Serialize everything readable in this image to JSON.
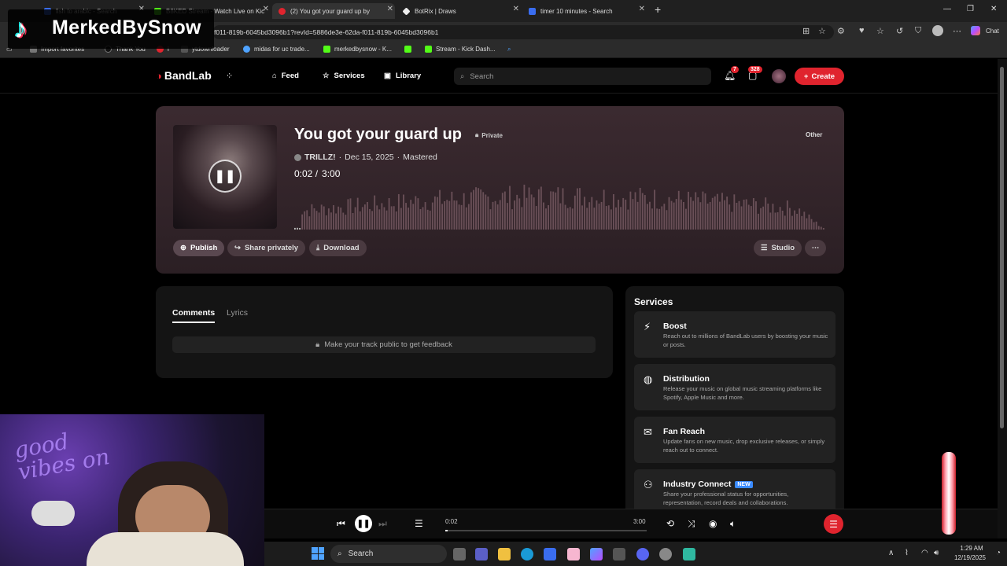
{
  "browser": {
    "tabs": [
      {
        "label": "lish to arabic - Search",
        "color": "#3a6df0"
      },
      {
        "label": "B8KED Stream - Watch Live on Kic",
        "color": "#53fc18"
      },
      {
        "label": "(2) You got your guard up by",
        "color": "#e0242e"
      },
      {
        "label": "BotRix | Draws",
        "color": "#eeeeee"
      },
      {
        "label": "timer 10 minutes - Search",
        "color": "#3a6df0"
      }
    ],
    "url": "f011-819b-6045bd3096b1?revId=5886de3e-62da-f011-819b-6045bd3096b1",
    "chat_label": "Chat",
    "bookmarks": [
      "Import favorites",
      "Thank You",
      "i",
      "ytdownloader",
      "midas for uc trade...",
      "merkedbysnow - K...",
      "Stream - Kick Dash..."
    ]
  },
  "nav": {
    "brand": "BandLab",
    "feed": "Feed",
    "services": "Services",
    "library": "Library",
    "search_placeholder": "Search",
    "notif_count": "7",
    "msg_count": "328",
    "create": "Create"
  },
  "track": {
    "title": "You got your guard up",
    "privacy": "Private",
    "genre": "Other",
    "artist": "TRILLZ!",
    "date": "Dec 15, 2025",
    "status": "Mastered",
    "time_current": "0:02 /",
    "time_total": "3:00",
    "publish": "Publish",
    "share": "Share privately",
    "download": "Download",
    "studio": "Studio"
  },
  "comments": {
    "tab_comments": "Comments",
    "tab_lyrics": "Lyrics",
    "locked_msg": "Make your track public to get feedback"
  },
  "services": {
    "heading": "Services",
    "items": [
      {
        "name": "Boost",
        "desc": "Reach out to millions of BandLab users by boosting your music or posts.",
        "icon": "lightning-icon"
      },
      {
        "name": "Distribution",
        "desc": "Release your music on global music streaming platforms like Spotify, Apple Music and more.",
        "icon": "globe-icon"
      },
      {
        "name": "Fan Reach",
        "desc": "Update fans on new music, drop exclusive releases, or simply reach out to connect.",
        "icon": "mail-icon"
      },
      {
        "name": "Industry Connect",
        "desc": "Share your professional status for opportunities, representation, record deals and collaborations.",
        "icon": "people-icon",
        "tag": "NEW"
      }
    ]
  },
  "player": {
    "current": "0:02",
    "total": "3:00",
    "progress": 0.011
  },
  "taskbar": {
    "search": "Search",
    "time": "1:29 AM",
    "date": "12/19/2025"
  },
  "overlay": {
    "tiktok_name": "MerkedBySnow",
    "neon_text": "good vibes on"
  },
  "colors": {
    "accent": "#e0242e",
    "card": "#3b2a30"
  }
}
